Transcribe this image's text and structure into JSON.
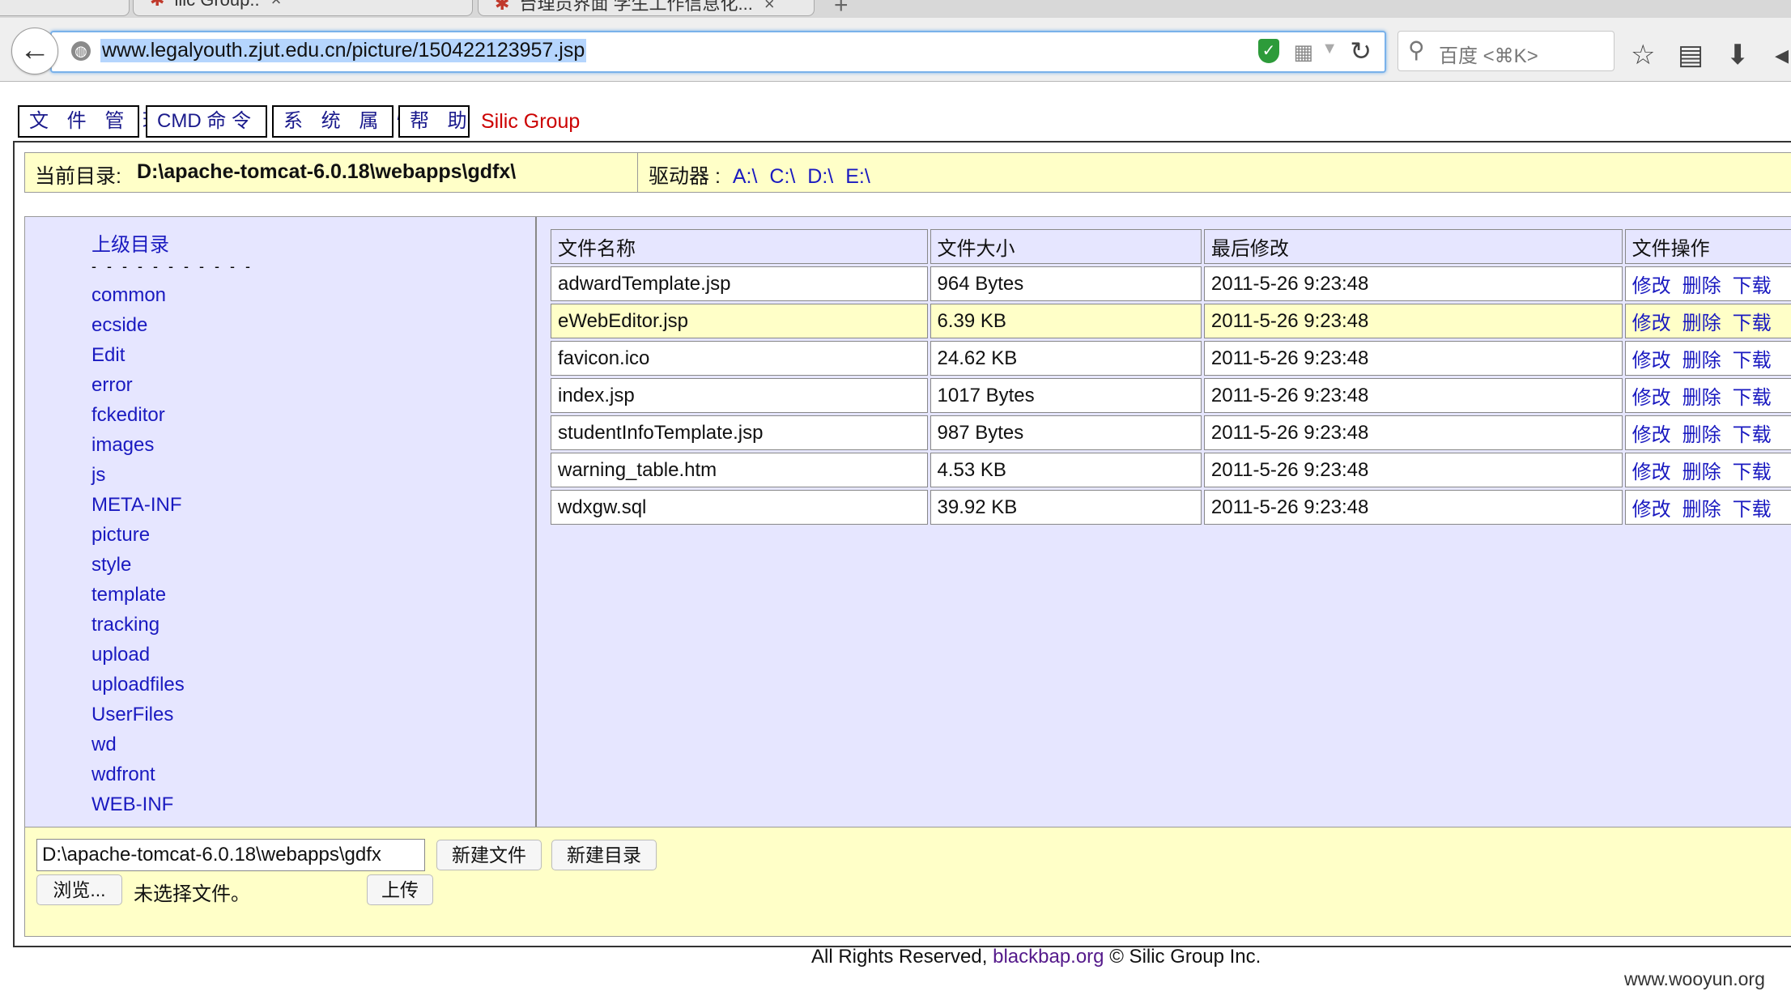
{
  "browser": {
    "tabs": [
      {
        "title": "ilic Group..",
        "close": "×"
      },
      {
        "title": "台理员界面 学生工作信息化...",
        "close": "×"
      }
    ],
    "new_tab": "+",
    "url": "www.legalyouth.zjut.edu.cn/picture/150422123957.jsp",
    "search_placeholder": "百度 <⌘K>",
    "icons": [
      "back-arrow-icon",
      "globe-icon",
      "shield-icon",
      "qr-code-icon",
      "reload-icon",
      "search-icon",
      "bookmark-star-icon",
      "reading-list-icon",
      "download-icon",
      "overflow-icon"
    ]
  },
  "nav": {
    "file_manage": "文 件 管 理",
    "cmd": "CMD 命 令",
    "sys_props": "系 统 属 性",
    "help": "帮 助",
    "brand": "Silic Group"
  },
  "pathbar": {
    "current_label": "当前目录:",
    "current_path": "D:\\apache-tomcat-6.0.18\\webapps\\gdfx\\",
    "drives_label": "驱动器 :",
    "drives": [
      "A:\\",
      "C:\\",
      "D:\\",
      "E:\\"
    ]
  },
  "sidebar": {
    "up_dir": "上级目录",
    "dashes": "- - - - - - - - - - -",
    "dirs": [
      "common",
      "ecside",
      "Edit",
      "error",
      "fckeditor",
      "images",
      "js",
      "META-INF",
      "picture",
      "style",
      "template",
      "tracking",
      "upload",
      "uploadfiles",
      "UserFiles",
      "wd",
      "wdfront",
      "WEB-INF"
    ]
  },
  "table": {
    "headers": [
      "文件名称",
      "文件大小",
      "最后修改",
      "文件操作"
    ],
    "rows": [
      {
        "name": "adwardTemplate.jsp",
        "size": "964 Bytes",
        "modified": "2011-5-26 9:23:48"
      },
      {
        "name": "eWebEditor.jsp",
        "size": "6.39 KB",
        "modified": "2011-5-26 9:23:48"
      },
      {
        "name": "favicon.ico",
        "size": "24.62 KB",
        "modified": "2011-5-26 9:23:48"
      },
      {
        "name": "index.jsp",
        "size": "1017 Bytes",
        "modified": "2011-5-26 9:23:48"
      },
      {
        "name": "studentInfoTemplate.jsp",
        "size": "987 Bytes",
        "modified": "2011-5-26 9:23:48"
      },
      {
        "name": "warning_table.htm",
        "size": "4.53 KB",
        "modified": "2011-5-26 9:23:48"
      },
      {
        "name": "wdxgw.sql",
        "size": "39.92 KB",
        "modified": "2011-5-26 9:23:48"
      }
    ],
    "ops": {
      "edit": "修改",
      "delete": "删除",
      "download": "下载"
    }
  },
  "bottom": {
    "path_value": "D:\\apache-tomcat-6.0.18\\webapps\\gdfx",
    "new_file": "新建文件",
    "new_dir": "新建目录",
    "browse": "浏览...",
    "no_file": "未选择文件。",
    "upload": "上传"
  },
  "footer": {
    "prefix": "All Rights Reserved,",
    "link": "blackbap.org",
    "suffix": "© Silic Group Inc."
  },
  "watermark": "www.wooyun.org"
}
